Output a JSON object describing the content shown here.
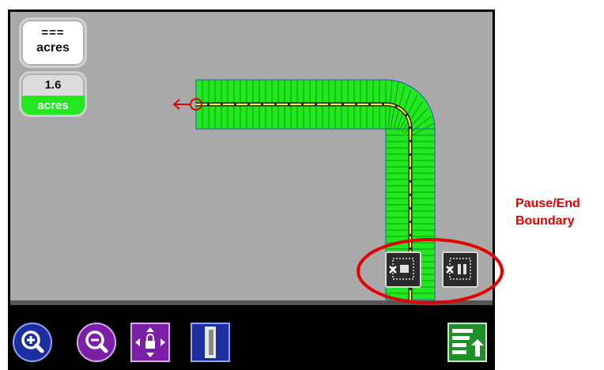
{
  "map": {
    "total_area": {
      "value": "===",
      "unit": "acres"
    },
    "covered_area": {
      "value": "1.6",
      "unit": "acres"
    }
  },
  "boundary_controls": {
    "end_boundary": {
      "icon": "end-boundary-icon"
    },
    "pause_boundary": {
      "icon": "pause-boundary-icon"
    }
  },
  "toolbar": {
    "zoom_in": {
      "icon": "zoom-in-icon"
    },
    "zoom_out": {
      "icon": "zoom-out-icon"
    },
    "pan": {
      "icon": "pan-lock-icon"
    },
    "split_view": {
      "icon": "split-view-icon"
    },
    "layers": {
      "icon": "layers-icon"
    }
  },
  "annotation": {
    "line1": "Pause/End",
    "line2": "Boundary"
  },
  "colors": {
    "coverage": "#22e822",
    "map_background": "#a9a9a9",
    "guidance_line": "#ffff00",
    "annotation": "#e20000"
  }
}
